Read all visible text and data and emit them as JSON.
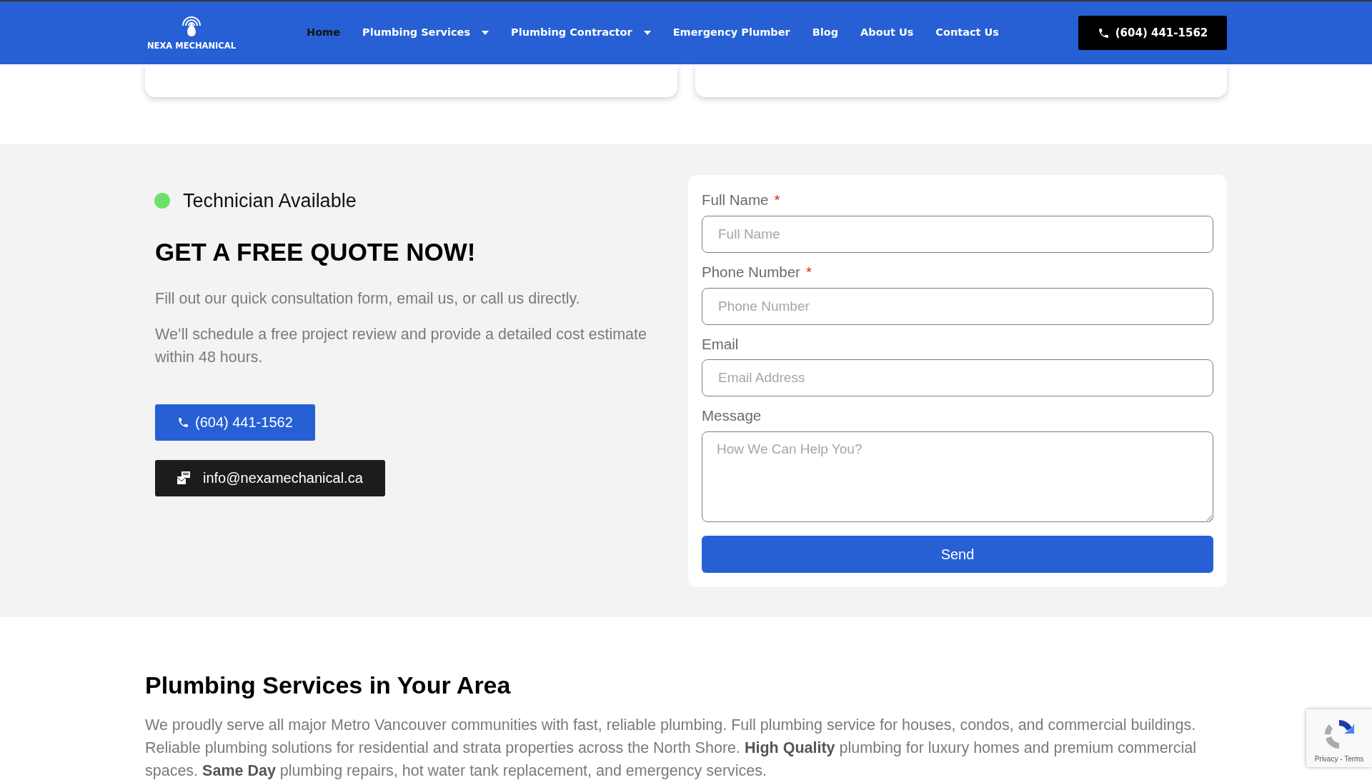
{
  "header": {
    "logo_text": "NEXA MECHANICAL",
    "nav": [
      {
        "label": "Home",
        "selected": true,
        "dropdown": false
      },
      {
        "label": "Plumbing Services",
        "selected": false,
        "dropdown": true
      },
      {
        "label": "Plumbing Contractor",
        "selected": false,
        "dropdown": true
      },
      {
        "label": "Emergency Plumber",
        "selected": false,
        "dropdown": false
      },
      {
        "label": "Blog",
        "selected": false,
        "dropdown": false
      },
      {
        "label": "About Us",
        "selected": false,
        "dropdown": false
      },
      {
        "label": "Contact Us",
        "selected": false,
        "dropdown": false
      }
    ],
    "phone_button": "(604) 441-1562"
  },
  "quote": {
    "status": {
      "label": "Technician Available",
      "available": true
    },
    "heading": "GET A FREE QUOTE NOW!",
    "paragraphs": [
      "Fill out our quick consultation form, email us, or call us directly.",
      "We’ll schedule a free project review and provide a detailed cost estimate within 48 hours."
    ],
    "phone_button": "(604) 441-1562",
    "email_button": "info@nexamechanical.ca"
  },
  "form": {
    "fields": [
      {
        "kind": "input",
        "label": "Full Name",
        "required": true,
        "placeholder": "Full Name"
      },
      {
        "kind": "input",
        "label": "Phone Number",
        "required": true,
        "placeholder": "Phone Number"
      },
      {
        "kind": "input",
        "label": "Email",
        "required": false,
        "placeholder": "Email Address"
      },
      {
        "kind": "textarea",
        "label": "Message",
        "required": false,
        "placeholder": "How We Can Help You?"
      }
    ],
    "submit": "Send",
    "required_mark": "*"
  },
  "area": {
    "heading": "Plumbing Services in Your Area",
    "paragraph": "We proudly serve all major Metro Vancouver communities with fast, reliable plumbing. Full plumbing service for houses, condos, and commercial buildings. Reliable plumbing solutions for residential and strata properties across the North Shore. **High Quality** plumbing for luxury homes and premium commercial spaces. **Same Day** plumbing repairs, hot water tank replacement, and emergency services."
  },
  "recaptcha": {
    "links": "Privacy - Terms"
  }
}
